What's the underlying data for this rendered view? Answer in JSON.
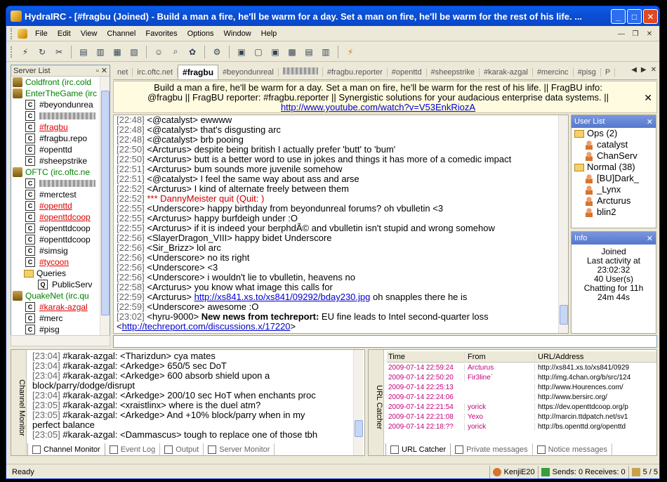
{
  "window": {
    "title": "HydraIRC - [#fragbu (Joined) - Build a man a fire, he'll be warm for a day. Set a man on fire, he'll be warm for the rest of his life. ..."
  },
  "menu": [
    "File",
    "Edit",
    "View",
    "Channel",
    "Favorites",
    "Options",
    "Window",
    "Help"
  ],
  "server_list": {
    "title": "Server List",
    "items": [
      {
        "kind": "server",
        "label": "Coldfront (irc.cold",
        "color": "green"
      },
      {
        "kind": "server",
        "label": "EnterTheGame (irc",
        "color": "green"
      },
      {
        "kind": "channel",
        "label": "#beyondunrea",
        "style": "normal"
      },
      {
        "kind": "channel",
        "label": "",
        "style": "blur"
      },
      {
        "kind": "channel",
        "label": "#fragbu",
        "style": "red"
      },
      {
        "kind": "channel",
        "label": "#fragbu.repo",
        "style": "normal"
      },
      {
        "kind": "channel",
        "label": "#openttd",
        "style": "normal"
      },
      {
        "kind": "channel",
        "label": "#sheepstrike",
        "style": "normal"
      },
      {
        "kind": "server",
        "label": "OFTC (irc.oftc.ne",
        "color": "green"
      },
      {
        "kind": "channel",
        "label": "",
        "style": "blur"
      },
      {
        "kind": "channel",
        "label": "#merctest",
        "style": "normal"
      },
      {
        "kind": "channel",
        "label": "#openttd",
        "style": "red"
      },
      {
        "kind": "channel",
        "label": "#openttdcoop",
        "style": "red"
      },
      {
        "kind": "channel",
        "label": "#openttdcoop",
        "style": "normal"
      },
      {
        "kind": "channel",
        "label": "#openttdcoop",
        "style": "normal"
      },
      {
        "kind": "channel",
        "label": "#simsig",
        "style": "normal"
      },
      {
        "kind": "channel",
        "label": "#tycoon",
        "style": "red"
      },
      {
        "kind": "folder",
        "label": "Queries",
        "style": "normal"
      },
      {
        "kind": "query",
        "label": "PublicServ",
        "style": "normal"
      },
      {
        "kind": "server",
        "label": "QuakeNet (irc.qu",
        "color": "green"
      },
      {
        "kind": "channel",
        "label": "#karak-azgal",
        "style": "red"
      },
      {
        "kind": "channel",
        "label": "#merc",
        "style": "normal"
      },
      {
        "kind": "channel",
        "label": "#pisg",
        "style": "normal"
      }
    ]
  },
  "tabs": [
    "net",
    "irc.oftc.net",
    "#fragbu",
    "#beyondunreal",
    "",
    "#fragbu.reporter",
    "#openttd",
    "#sheepstrike",
    "#karak-azgal",
    "#mercinc",
    "#pisg",
    "P"
  ],
  "topic": {
    "line1": "Build a man a fire, he'll be warm for a day. Set a man on fire, he'll be warm for the rest of his life. || FragBU info:",
    "line2": "@fragbu || FragBU reporter: #fragbu.reporter || Synergistic solutions for your audacious enterprise data systems. ||",
    "link": "http://www.youtube.com/watch?v=V53EnkRiozA"
  },
  "chat": [
    {
      "t": "[22:48]",
      "text": "<@catalyst> ewwww"
    },
    {
      "t": "[22:48]",
      "text": "<@catalyst> that's disgusting arc"
    },
    {
      "t": "[22:48]",
      "text": "<@catalyst> brb pooing"
    },
    {
      "t": "[22:50]",
      "text": "<Arcturus> despite being british I actually prefer 'butt' to 'bum'"
    },
    {
      "t": "[22:50]",
      "text": "<Arcturus> butt is a better word to use in jokes and things it has more of a comedic impact"
    },
    {
      "t": "[22:51]",
      "text": "<Arcturus> bum sounds more juvenile somehow"
    },
    {
      "t": "[22:51]",
      "text": "<@catalyst> I feel the same way about ass and arse"
    },
    {
      "t": "[22:52]",
      "text": "<Arcturus> I kind of alternate freely between them"
    },
    {
      "t": "[22:52]",
      "text": "*** DannyMeister quit (Quit: )",
      "type": "quit"
    },
    {
      "t": "[22:55]",
      "text": "<Underscore> happy birthday from beyondunreal forums? oh vbulletin <3"
    },
    {
      "t": "[22:55]",
      "text": "<Arcturus> happy burfdeigh under :O"
    },
    {
      "t": "[22:55]",
      "text": "<Arcturus> if it is indeed your berphdÃ© and vbulletin isn't stupid and wrong somehow"
    },
    {
      "t": "[22:56]",
      "text": "<SlayerDragon_VIII> happy bidet Underscore"
    },
    {
      "t": "[22:56]",
      "text": "<Sir_Brizz> lol arc"
    },
    {
      "t": "[22:56]",
      "text": "<Underscore> no its right"
    },
    {
      "t": "[22:56]",
      "text": "<Underscore> <3"
    },
    {
      "t": "[22:56]",
      "text": "<Underscore> i wouldn't lie to vbulletin, heavens no"
    },
    {
      "t": "[22:58]",
      "text": "<Arcturus> you know what image this calls for"
    },
    {
      "t": "[22:59]",
      "text": "<Arcturus> ",
      "link": "http://xs841.xs.to/xs841/09292/bday230.jpg",
      "after": " oh snapples there he is"
    },
    {
      "t": "[22:59]",
      "text": "<Underscore> awesome :O"
    },
    {
      "t": "[23:02]",
      "text": "<hyru-9000> ",
      "bold": "New news from techreport:",
      "after": " EU fine leads to Intel second-quarter loss"
    },
    {
      "t": "",
      "text": "  <",
      "link": "http://techreport.com/discussions.x/17220",
      "after": ">"
    }
  ],
  "user_list": {
    "title": "User List",
    "items": [
      {
        "kind": "group",
        "label": "Ops (2)"
      },
      {
        "kind": "user",
        "label": "catalyst"
      },
      {
        "kind": "user",
        "label": "ChanServ"
      },
      {
        "kind": "group",
        "label": "Normal (38)"
      },
      {
        "kind": "user",
        "label": "[BU]Dark_"
      },
      {
        "kind": "user",
        "label": "_Lynx"
      },
      {
        "kind": "user",
        "label": "Arcturus"
      },
      {
        "kind": "user",
        "label": "blin2"
      }
    ]
  },
  "info": {
    "title": "Info",
    "lines": [
      "Joined",
      "Last activity at",
      "23:02:32",
      "40 User(s)",
      "Chatting for 11h",
      "24m 44s"
    ]
  },
  "channel_monitor": {
    "label": "Channel Monitor",
    "lines": [
      {
        "t": "[23:04]",
        "text": "#karak-azgal: <Tharizdun> cya mates"
      },
      {
        "t": "[23:04]",
        "text": "#karak-azgal: <Arkedge> 650/5 sec DoT"
      },
      {
        "t": "[23:04]",
        "text": "#karak-azgal: <Arkedge> 600 absorb shield upon a"
      },
      {
        "t": "",
        "text": "   block/parry/dodge/disrupt"
      },
      {
        "t": "[23:04]",
        "text": "#karak-azgal: <Arkedge> 200/10 sec HoT when enchants proc"
      },
      {
        "t": "[23:05]",
        "text": "#karak-azgal: <xraistlinx> where is the duel atm?"
      },
      {
        "t": "[23:05]",
        "text": "#karak-azgal: <Arkedge> And +10% block/parry when in my"
      },
      {
        "t": "",
        "text": "   perfect balance"
      },
      {
        "t": "[23:05]",
        "text": "#karak-azgal: <Dammascus> tough to replace one of those tbh"
      }
    ]
  },
  "bottom_left_tabs": [
    "Channel Monitor",
    "Event Log",
    "Output",
    "Server Monitor"
  ],
  "url_catcher": {
    "label": "URL Catcher",
    "columns": [
      "Time",
      "From",
      "URL/Address"
    ],
    "rows": [
      [
        "2009-07-14 22:59:24",
        "Arcturus",
        "http://xs841.xs.to/xs841/0929"
      ],
      [
        "2009-07-14 22:50:20",
        "Fir3line`",
        "http://img.4chan.org/b/src/124"
      ],
      [
        "2009-07-14 22:25:13",
        "",
        "http://www.Hourences.com/"
      ],
      [
        "2009-07-14 22:24:06",
        "",
        "http://www.bersirc.org/"
      ],
      [
        "2009-07-14 22:21:54",
        "yorick",
        "https://dev.openttdcoop.org/p"
      ],
      [
        "2009-07-14 22:21:08",
        "Yexo",
        "http://marcin.ttdpatch.net/sv1"
      ],
      [
        "2009-07-14 22:18:??",
        "yorick",
        "http://bs.openttd.org/openttd"
      ]
    ]
  },
  "bottom_right_tabs": [
    "URL Catcher",
    "Private messages",
    "Notice messages"
  ],
  "status": {
    "ready": "Ready",
    "nick": "KenjiE20",
    "sends": "Sends: 0 Receives: 0",
    "count": "5 / 5"
  }
}
